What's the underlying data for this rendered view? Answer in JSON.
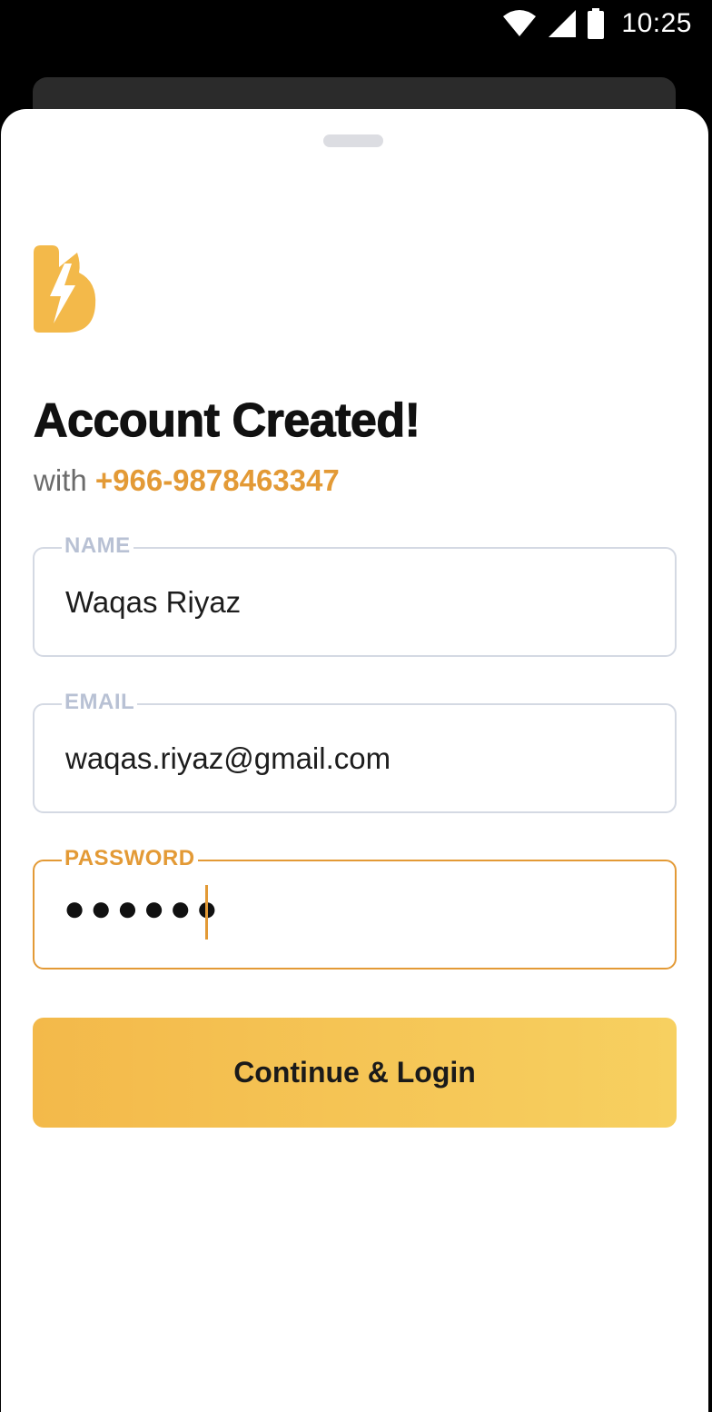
{
  "status_bar": {
    "time": "10:25"
  },
  "brand": {
    "logo_icon": "lightning-b-logo",
    "accent_color": "#f3b94a"
  },
  "header": {
    "title": "Account Created!",
    "subtitle_prefix": "with",
    "phone": "+966-9878463347"
  },
  "form": {
    "name": {
      "label": "NAME",
      "value": "Waqas Riyaz"
    },
    "email": {
      "label": "EMAIL",
      "value": "waqas.riyaz@gmail.com"
    },
    "password": {
      "label": "PASSWORD",
      "masked_value": "●●●●●●"
    }
  },
  "actions": {
    "continue_label": "Continue & Login"
  },
  "colors": {
    "accent": "#e39a36",
    "field_border": "#d4d9e3",
    "label_inactive": "#b8c1d4"
  }
}
